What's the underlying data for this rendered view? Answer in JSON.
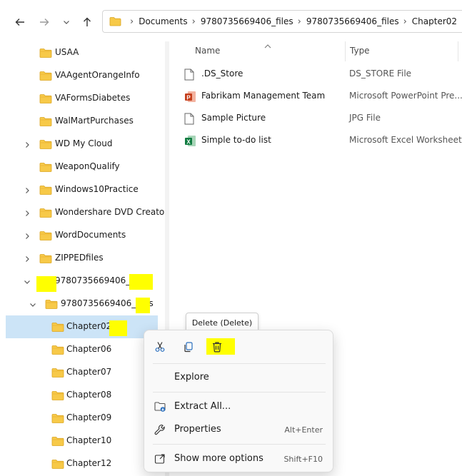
{
  "toolbar": {
    "back_icon": "back-arrow-icon",
    "forward_icon": "forward-arrow-icon",
    "recent_icon": "chevron-down-icon",
    "up_icon": "up-arrow-icon"
  },
  "address_bar": {
    "breadcrumbs": [
      "Documents",
      "9780735669406_files",
      "9780735669406_files",
      "Chapter02"
    ]
  },
  "nav_pane": {
    "items": [
      {
        "label": "USAA",
        "expandable": false
      },
      {
        "label": "VAAgentOrangeInfo",
        "expandable": false
      },
      {
        "label": "VAFormsDiabetes",
        "expandable": false
      },
      {
        "label": "WalMartPurchases",
        "expandable": false
      },
      {
        "label": "WD My Cloud",
        "expandable": true
      },
      {
        "label": "WeaponQualify",
        "expandable": false
      },
      {
        "label": "Windows10Practice",
        "expandable": true
      },
      {
        "label": "Wondershare DVD Creator",
        "expandable": true
      },
      {
        "label": "WordDocuments",
        "expandable": true
      },
      {
        "label": "ZIPPEDfiles",
        "expandable": true
      },
      {
        "label": "9780735669406_files",
        "expandable": true,
        "expanded": true
      },
      {
        "label": "9780735669406_files",
        "expandable": true,
        "expanded": true
      },
      {
        "label": "Chapter02",
        "selected": true
      },
      {
        "label": "Chapter06"
      },
      {
        "label": "Chapter07"
      },
      {
        "label": "Chapter08"
      },
      {
        "label": "Chapter09"
      },
      {
        "label": "Chapter10"
      },
      {
        "label": "Chapter12"
      }
    ]
  },
  "file_list": {
    "columns": {
      "name": "Name",
      "type": "Type"
    },
    "files": [
      {
        "name": ".DS_Store",
        "type": "DS_STORE File",
        "icon": "blank-file-icon"
      },
      {
        "name": "Fabrikam Management Team",
        "type": "Microsoft PowerPoint Pre...",
        "icon": "powerpoint-file-icon"
      },
      {
        "name": "Sample Picture",
        "type": "JPG File",
        "icon": "blank-file-icon"
      },
      {
        "name": "Simple to-do list",
        "type": "Microsoft Excel Worksheet",
        "icon": "excel-file-icon"
      }
    ]
  },
  "tooltip": {
    "text": "Delete (Delete)"
  },
  "context_menu": {
    "icon_buttons": [
      "cut-icon",
      "copy-icon",
      "delete-icon"
    ],
    "items": [
      {
        "label": "Explore",
        "shortcut": ""
      },
      {
        "label": "Extract All...",
        "shortcut": ""
      },
      {
        "label": "Properties",
        "shortcut": "Alt+Enter"
      },
      {
        "label": "Show more options",
        "shortcut": "Shift+F10"
      }
    ]
  },
  "colors": {
    "highlight": "#ffff00",
    "selection": "#cce4f7",
    "folder": "#f7c948"
  }
}
